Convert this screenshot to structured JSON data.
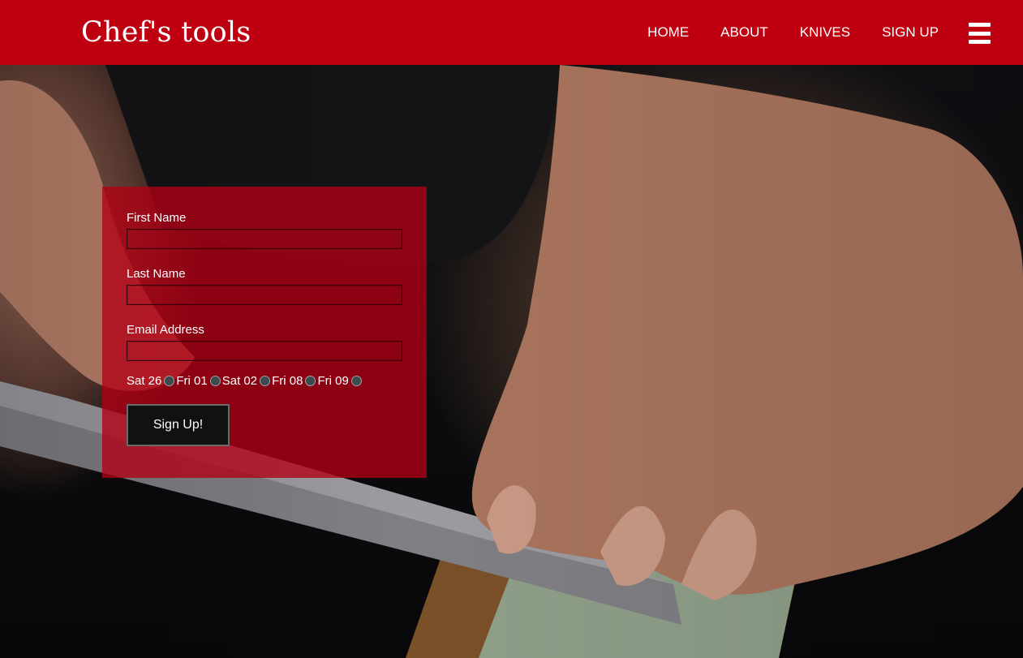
{
  "header": {
    "brand": "Chef's tools",
    "nav": [
      "HOME",
      "ABOUT",
      "KNIVES",
      "SIGN UP"
    ],
    "menu_icon": "hamburger-menu-icon"
  },
  "form": {
    "first_name_label": "First Name",
    "first_name_value": "",
    "last_name_label": "Last Name",
    "last_name_value": "",
    "email_label": "Email Address",
    "email_value": "",
    "dates": [
      "Sat 26",
      "Fri 01",
      "Sat 02",
      "Fri 08",
      "Fri 09"
    ],
    "submit_label": "Sign Up!"
  },
  "colors": {
    "brand_red": "#bf0011",
    "form_panel": "#b20014",
    "button_bg": "#111111"
  }
}
